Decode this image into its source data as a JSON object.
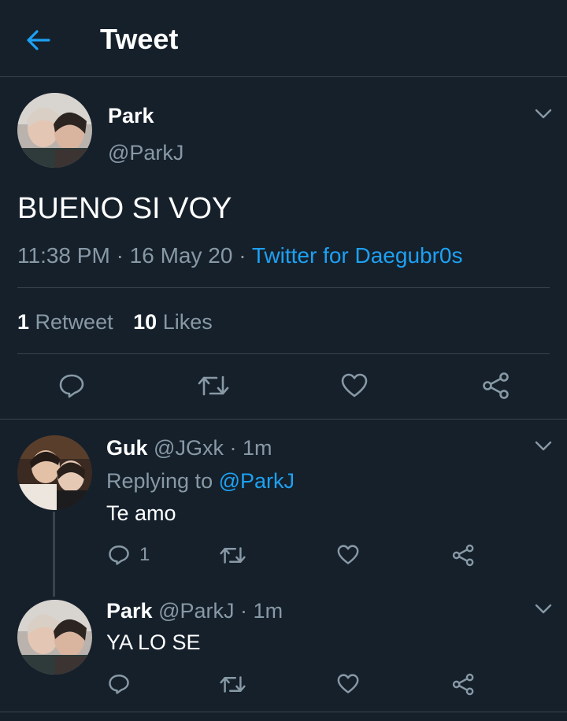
{
  "header": {
    "title": "Tweet"
  },
  "main_tweet": {
    "name": "Park",
    "handle": "@ParkJ",
    "text": "BUENO SI VOY",
    "time": "11:38 PM",
    "sep": "·",
    "date": "16 May 20",
    "source": "Twitter for Daegubr0s",
    "retweets_count": "1",
    "retweets_label": "Retweet",
    "likes_count": "10",
    "likes_label": "Likes"
  },
  "replies": [
    {
      "name": "Guk",
      "handle": "@JGxk",
      "sep": "·",
      "time": "1m",
      "replying_prefix": "Replying to",
      "replying_to": "@ParkJ",
      "text": "Te amo",
      "reply_count": "1"
    },
    {
      "name": "Park",
      "handle": "@ParkJ",
      "sep": "·",
      "time": "1m",
      "text": "YA LO SE"
    }
  ],
  "colors": {
    "background": "#15202b",
    "accent": "#1da1f2",
    "muted": "#8899a6",
    "divider": "#38444d"
  },
  "icons": [
    "back-arrow-icon",
    "chevron-down-icon",
    "reply-icon",
    "retweet-icon",
    "like-icon",
    "share-icon"
  ]
}
